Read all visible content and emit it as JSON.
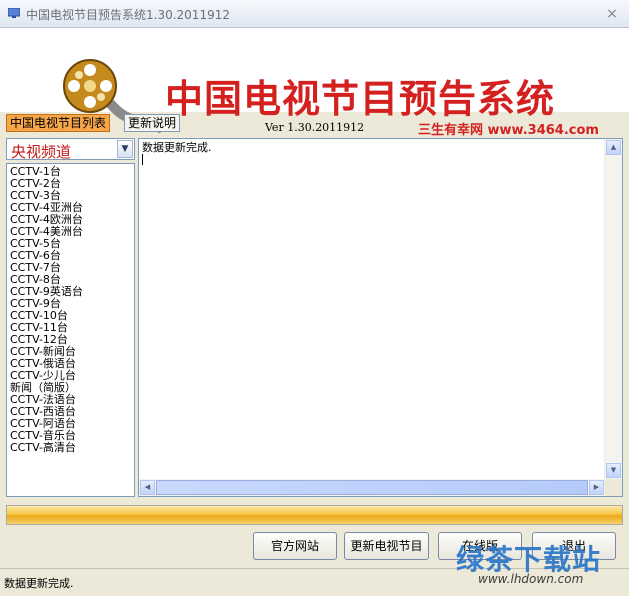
{
  "window": {
    "title": "中国电视节目预告系统1.30.2011912",
    "close_glyph": "×"
  },
  "banner": {
    "headline": "中国电视节目预告系统",
    "version": "Ver 1.30.2011912",
    "site": "三生有幸网 www.3464.com"
  },
  "tabs": {
    "program_list": "中国电视节目列表",
    "update_notes": "更新说明"
  },
  "channel_select": {
    "value": "央视频道",
    "arrow": "▼"
  },
  "channels": [
    "CCTV-1台",
    "CCTV-2台",
    "CCTV-3台",
    "CCTV-4亚洲台",
    "CCTV-4欧洲台",
    "CCTV-4美洲台",
    "CCTV-5台",
    "CCTV-6台",
    "CCTV-7台",
    "CCTV-8台",
    "CCTV-9英语台",
    "CCTV-9台",
    "CCTV-10台",
    "CCTV-11台",
    "CCTV-12台",
    "CCTV-新闻台",
    "CCTV-俄语台",
    "CCTV-少儿台",
    "新闻（简版）",
    "CCTV-法语台",
    "CCTV-西语台",
    "CCTV-阿语台",
    "CCTV-音乐台",
    "CCTV-高清台"
  ],
  "content": {
    "text": "数据更新完成."
  },
  "progress": {
    "value": 1.0
  },
  "buttons": {
    "official_site": "官方网站",
    "update_programs": "更新电视节目",
    "online": "在线版",
    "exit": "退出"
  },
  "status": {
    "text": "数据更新完成."
  },
  "watermark": {
    "logo_text": "绿茶下载站",
    "url": "www.lhdown.com"
  },
  "colors": {
    "accent_red": "#d4201e",
    "tab_active": "#f7a64a",
    "progress": "#f6c744"
  }
}
